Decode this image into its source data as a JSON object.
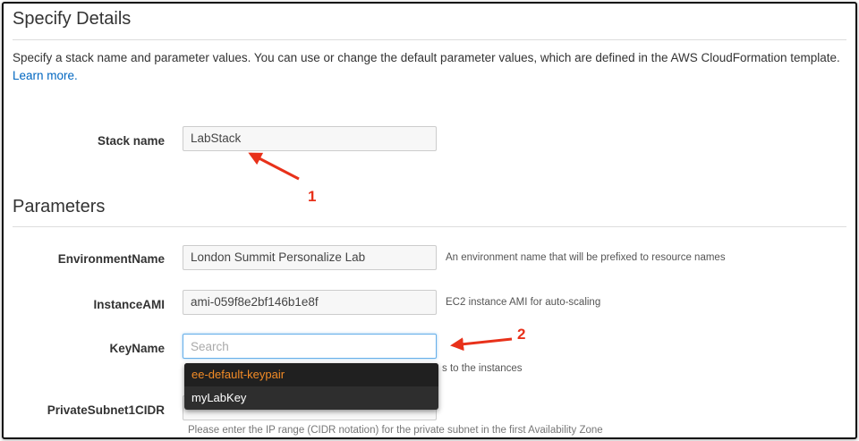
{
  "specify": {
    "title": "Specify Details",
    "description": "Specify a stack name and parameter values. You can use or change the default parameter values, which are defined in the AWS CloudFormation template.",
    "learn_more": "Learn more."
  },
  "stack": {
    "label": "Stack name",
    "value": "LabStack"
  },
  "parameters": {
    "title": "Parameters",
    "environment_name": {
      "label": "EnvironmentName",
      "value": "London Summit Personalize Lab",
      "help": "An environment name that will be prefixed to resource names"
    },
    "instance_ami": {
      "label": "InstanceAMI",
      "value": "ami-059f8e2bf146b1e8f",
      "help": "EC2 instance AMI for auto-scaling"
    },
    "key_name": {
      "label": "KeyName",
      "placeholder": "Search",
      "help_fragment": "s to the instances",
      "options": [
        "ee-default-keypair",
        "myLabKey"
      ]
    },
    "private_subnet": {
      "label": "PrivateSubnet1CIDR",
      "help": "Please enter the IP range (CIDR notation) for the private subnet in the first Availability Zone"
    }
  },
  "annotations": {
    "marker_1": "1",
    "marker_2": "2",
    "color": "#e8311a"
  },
  "colors": {
    "link": "#0066c0",
    "dropdown_bg": "#2e2e2e",
    "dropdown_active_text": "#f28b26",
    "focus_border": "#66afe9"
  }
}
